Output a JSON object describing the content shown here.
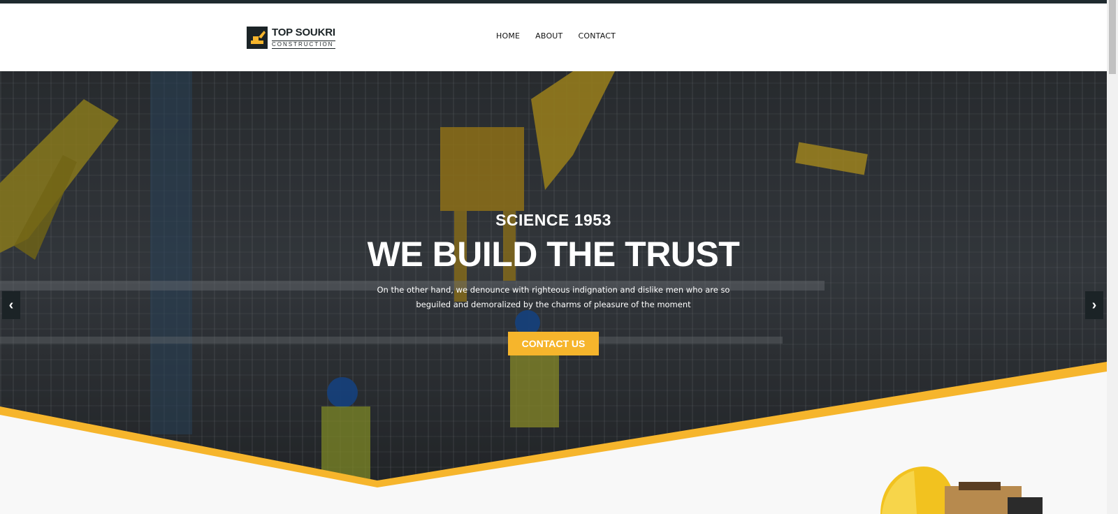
{
  "logo": {
    "title": "TOP SOUKRI",
    "subtitle": "CONSTRUCTION"
  },
  "nav": {
    "items": [
      {
        "label": "HOME"
      },
      {
        "label": "ABOUT"
      },
      {
        "label": "CONTACT"
      }
    ]
  },
  "hero": {
    "kicker": "SCIENCE 1953",
    "title": "WE BUILD THE TRUST",
    "description_line1": "On the other hand, we denounce with righteous indignation and dislike men who are so",
    "description_line2": "beguiled and demoralized by the charms of pleasure of the moment",
    "cta_label": "CONTACT US"
  },
  "slider": {
    "prev_icon": "chevron-left-icon",
    "next_icon": "chevron-right-icon"
  },
  "colors": {
    "accent": "#f6b52c",
    "dark": "#1b2326",
    "light_bg": "#f8f8f8"
  }
}
